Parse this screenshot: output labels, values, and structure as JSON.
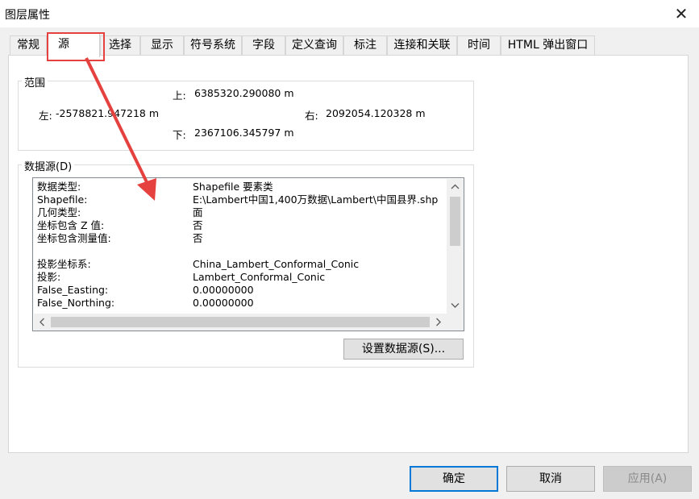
{
  "window": {
    "title": "图层属性",
    "close_glyph": "✕"
  },
  "tabs": [
    {
      "label": "常规"
    },
    {
      "label": "源"
    },
    {
      "label": "选择"
    },
    {
      "label": "显示"
    },
    {
      "label": "符号系统"
    },
    {
      "label": "字段"
    },
    {
      "label": "定义查询"
    },
    {
      "label": "标注"
    },
    {
      "label": "连接和关联"
    },
    {
      "label": "时间"
    },
    {
      "label": "HTML 弹出窗口"
    }
  ],
  "active_tab": "源",
  "extent": {
    "legend": "范围",
    "top": {
      "label": "上:",
      "value": "6385320.290080 m"
    },
    "left": {
      "label": "左:",
      "value": "-2578821.947218 m"
    },
    "right": {
      "label": "右:",
      "value": "2092054.120328 m"
    },
    "bottom": {
      "label": "下:",
      "value": "2367106.345797 m"
    }
  },
  "datasource": {
    "legend": "数据源(D)",
    "rows": [
      {
        "key": "数据类型:",
        "value": "Shapefile 要素类"
      },
      {
        "key": "Shapefile:",
        "value": "E:\\Lambert中国1,400万数据\\Lambert\\中国县界.shp"
      },
      {
        "key": "几何类型:",
        "value": "面"
      },
      {
        "key": "坐标包含 Z 值:",
        "value": "否"
      },
      {
        "key": "坐标包含测量值:",
        "value": "否"
      },
      {
        "key": "",
        "value": ""
      },
      {
        "key": "投影坐标系:",
        "value": "China_Lambert_Conformal_Conic"
      },
      {
        "key": "投影:",
        "value": "Lambert_Conformal_Conic"
      },
      {
        "key": "False_Easting:",
        "value": "0.00000000"
      },
      {
        "key": "False_Northing:",
        "value": "0.00000000"
      }
    ],
    "set_button": "设置数据源(S)..."
  },
  "footer": {
    "ok": "确定",
    "cancel": "取消",
    "apply": "应用(A)"
  },
  "annotation_colors": {
    "highlight": "#e5413e",
    "arrow": "#e5413e",
    "primary_border": "#0078d7"
  }
}
